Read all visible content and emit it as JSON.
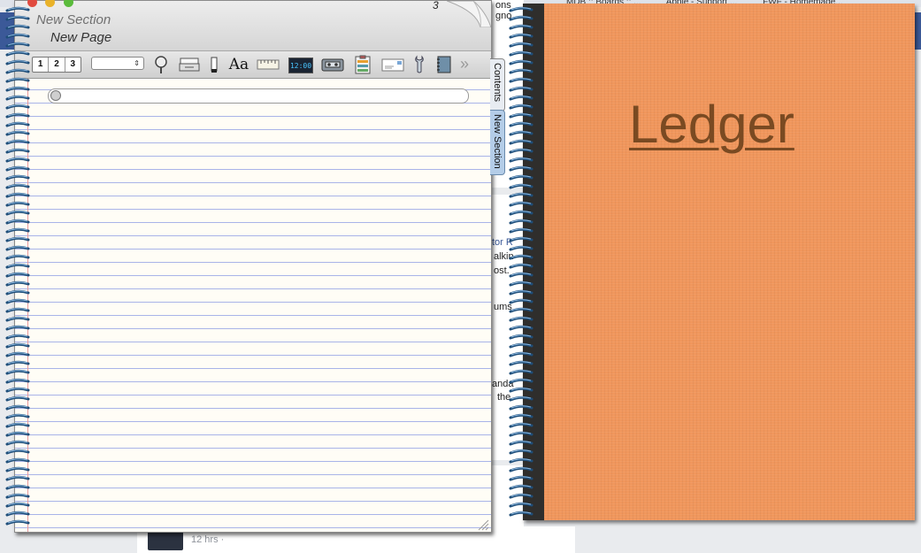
{
  "background": {
    "tabs": [
      "MDB :: Boards :: ...",
      "Apple - Support ...",
      "FWF - Homemade..."
    ],
    "fragments": [
      {
        "text": "ons",
        "cls": "",
        "left": 0,
        "top": 0
      },
      {
        "text": "gno",
        "cls": "",
        "left": 0,
        "top": 0
      },
      {
        "text": "tor R",
        "cls": "link",
        "left": 0,
        "top": 0
      },
      {
        "text": "alkin",
        "cls": "",
        "left": 0,
        "top": 0
      },
      {
        "text": "ost.",
        "cls": "",
        "left": 0,
        "top": 0
      },
      {
        "text": "ums",
        "cls": "",
        "left": 0,
        "top": 0
      },
      {
        "text": "anda",
        "cls": "",
        "left": 0,
        "top": 0
      },
      {
        "text": "the",
        "cls": "",
        "left": 0,
        "top": 0
      }
    ],
    "post_time": "12 hrs · "
  },
  "notebook": {
    "section_title": "New Section",
    "page_title": "New Page",
    "page_number": "3",
    "toolbar": {
      "segments": [
        "1",
        "2",
        "3"
      ],
      "dropdown_value": "",
      "font_label": "Aa",
      "clock_label": "12:00"
    },
    "tabs": {
      "contents": "Contents",
      "section": "New Section"
    }
  },
  "ledger": {
    "title": "Ledger",
    "cover_color": "#f0965c"
  }
}
